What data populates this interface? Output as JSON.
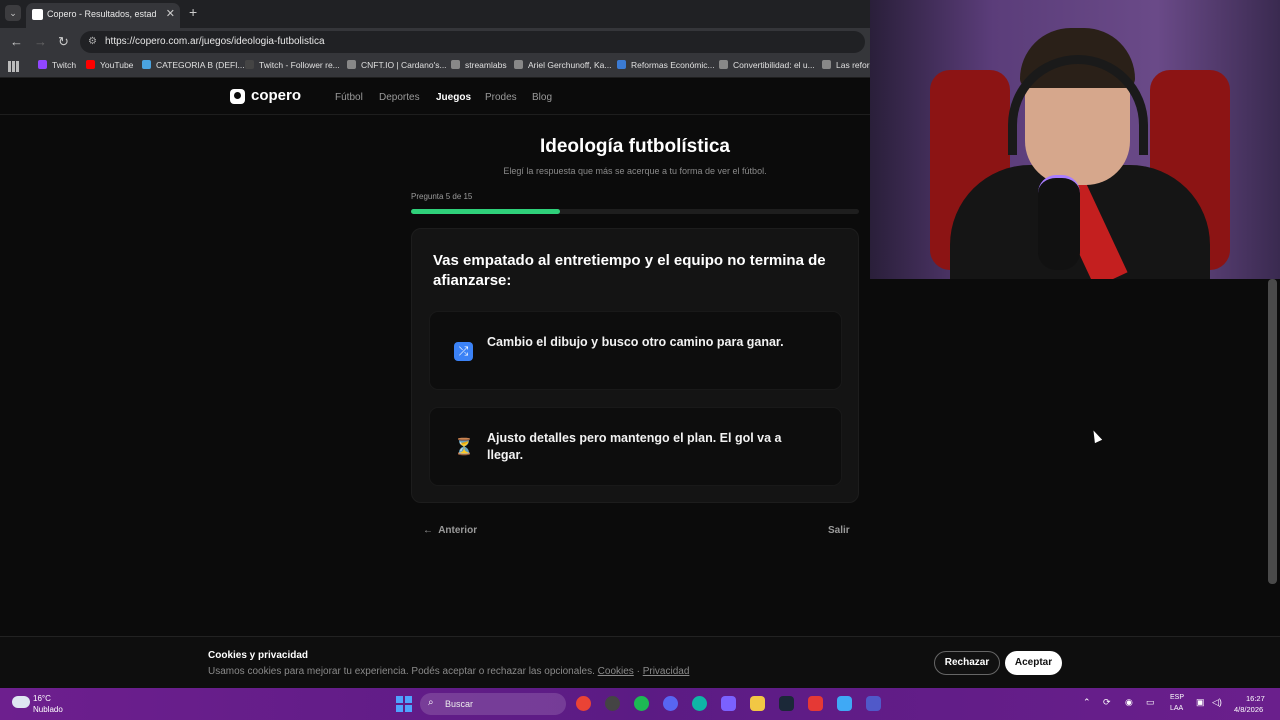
{
  "browser": {
    "tab_title": "Copero - Resultados, estadístic",
    "url": "https://copero.com.ar/juegos/ideologia-futbolistica",
    "bookmarks": [
      {
        "label": "Twitch",
        "color": "#9146ff"
      },
      {
        "label": "YouTube",
        "color": "#ff0000"
      },
      {
        "label": "CATEGORIA B (DEFI...",
        "color": "#4aa3df"
      },
      {
        "label": "Twitch - Follower re...",
        "color": "#444444"
      },
      {
        "label": "CNFT.IO | Cardano's...",
        "color": "#888888"
      },
      {
        "label": "streamlabs",
        "color": "#888888"
      },
      {
        "label": "Ariel Gerchunoff, Ka...",
        "color": "#888888"
      },
      {
        "label": "Reformas Económic...",
        "color": "#3b7bd4"
      },
      {
        "label": "Convertibilidad: el u...",
        "color": "#888888"
      },
      {
        "label": "Las refor",
        "color": "#888888"
      }
    ]
  },
  "site": {
    "brand": "copero",
    "nav": [
      "Fútbol",
      "Deportes",
      "Juegos",
      "Prodes",
      "Blog"
    ],
    "active_nav": "Juegos"
  },
  "quiz": {
    "title": "Ideología futbolística",
    "subtitle": "Elegí la respuesta que más se acerque a tu forma de ver el fútbol.",
    "question_counter": "Pregunta 5 de 15",
    "progress_fraction": 0.333,
    "question": "Vas empatado al entretiempo y el equipo no termina de afianzarse:",
    "options": [
      {
        "icon": "shuffle-icon",
        "glyph": "⤮",
        "text": "Cambio el dibujo y busco otro camino para ganar."
      },
      {
        "icon": "hourglass-icon",
        "glyph": "⏳",
        "text": "Ajusto detalles pero mantengo el plan. El gol va a llegar."
      }
    ],
    "prev_label": "Anterior",
    "exit_label": "Salir"
  },
  "cookie": {
    "title": "Cookies y privacidad",
    "text": "Usamos cookies para mejorar tu experiencia. Podés aceptar o rechazar las opcionales.",
    "link_cookies": "Cookies",
    "separator": "·",
    "link_privacy": "Privacidad",
    "reject": "Rechazar",
    "accept": "Aceptar"
  },
  "taskbar": {
    "temperature": "16°C",
    "condition": "Nublado",
    "search_placeholder": "Buscar",
    "lang_line1": "ESP",
    "lang_line2": "LAA",
    "time": "16:27",
    "date": "4/8/2026"
  },
  "colors": {
    "accent_green": "#2fd07a",
    "taskbar_purple": "#6d1f8e"
  }
}
